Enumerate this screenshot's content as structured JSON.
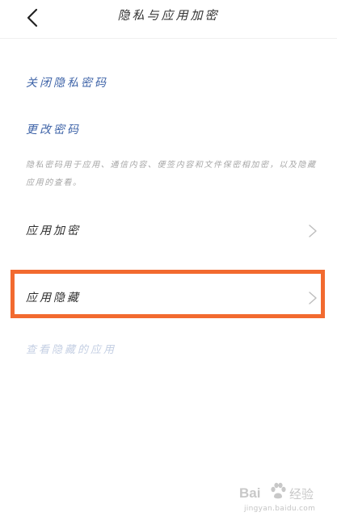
{
  "header": {
    "title": "隐私与应用加密",
    "back_icon": "chevron-left-icon"
  },
  "links": {
    "close_privacy_password": "关闭隐私密码",
    "change_password": "更改密码"
  },
  "description": "隐私密码用于应用、通信内容、便签内容和文件保密相加密，以及隐藏应用的查看。",
  "rows": {
    "app_encryption": "应用加密",
    "app_hide": "应用隐藏"
  },
  "view_hidden_apps": "查看隐藏的应用",
  "highlight_color": "#f26a2f",
  "link_color": "#3f64a8",
  "watermark": {
    "brand": "Bai",
    "suffix": "经验",
    "url": "jingyan.baidu.com"
  }
}
